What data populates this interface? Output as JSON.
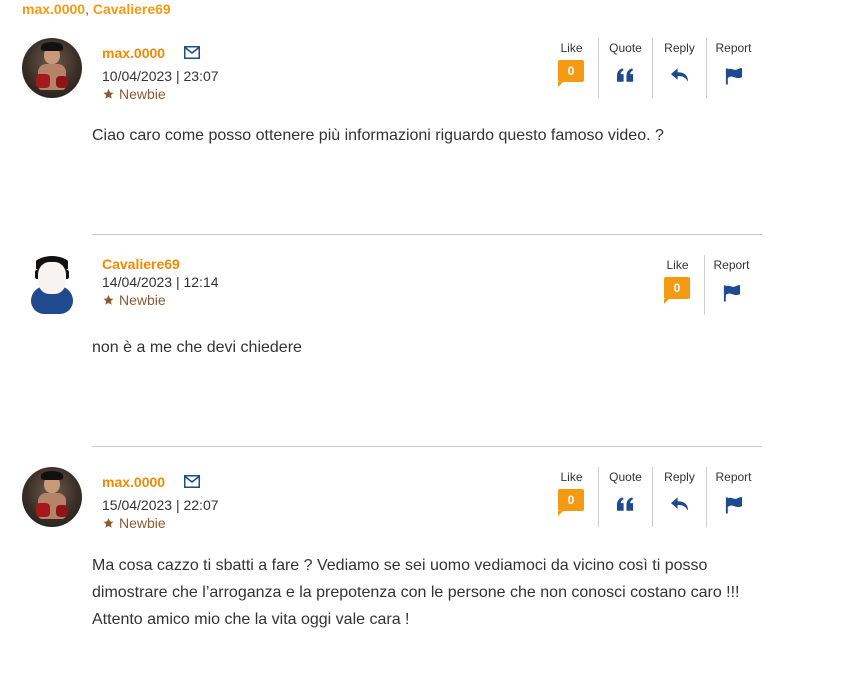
{
  "participants": {
    "names": [
      "max.0000",
      "Cavaliere69"
    ],
    "separator": ","
  },
  "posts": [
    {
      "username": "max.0000",
      "datetime": "10/04/2023 | 23:07",
      "rank": "Newbie",
      "likes": "0",
      "actions": {
        "like": "Like",
        "quote": "Quote",
        "reply": "Reply",
        "report": "Report"
      },
      "message": "Ciao caro come posso ottenere più informazioni riguardo questo famoso video. ?"
    },
    {
      "username": "Cavaliere69",
      "datetime": "14/04/2023 | 12:14",
      "rank": "Newbie",
      "likes": "0",
      "actions": {
        "like": "Like",
        "report": "Report"
      },
      "message": "non è a me che devi chiedere"
    },
    {
      "username": "max.0000",
      "datetime": "15/04/2023 | 22:07",
      "rank": "Newbie",
      "likes": "0",
      "actions": {
        "like": "Like",
        "quote": "Quote",
        "reply": "Reply",
        "report": "Report"
      },
      "message": "Ma cosa cazzo ti sbatti a fare ? Vediamo se sei uomo vediamoci da vicino così ti posso dimostrare che l’arroganza e la prepotenza con le persone che non conosci costano caro !!! Attento amico mio che la vita oggi vale cara !"
    }
  ],
  "colors": {
    "accent": "#f39a12",
    "username": "#f08a00",
    "icon": "#1f4a8e",
    "rank": "#8a5a35"
  }
}
